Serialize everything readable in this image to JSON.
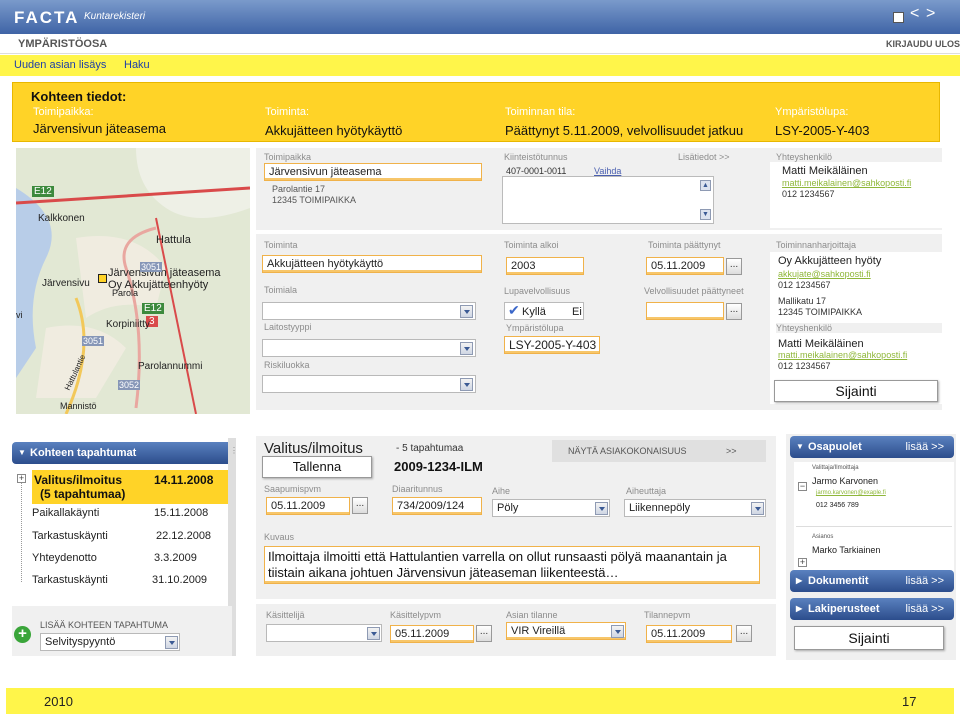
{
  "header": {
    "logo": "FACTA",
    "logo_sub": "Kuntarekisteri",
    "section": "YMPÄRISTÖOSA",
    "logout": "KIRJAUDU ULOS"
  },
  "nav": [
    "Uuden asian lisäys",
    "Haku"
  ],
  "case": {
    "heading": "Kohteen tiedot:",
    "place_label": "Toimipaikka:",
    "place": "Järvensivun jäteasema",
    "activity_label": "Toiminta:",
    "activity": "Akkujätteen hyötykäyttö",
    "status_label": "Toiminnan tila:",
    "status": "Päättynyt 5.11.2009, velvollisuudet jatkuu",
    "permit_label": "Ympäristölupa:",
    "permit": "LSY-2005-Y-403"
  },
  "site": {
    "place_label": "Toimipaikka",
    "place_value": "Järvensivun jäteasema",
    "address1": "Parolantie 17",
    "address2": "12345 TOIMIPAIKKA",
    "property_label": "Kiinteistötunnus",
    "property_value": "407-0001-0011",
    "change_link": "Vaihda",
    "more_info": "Lisätiedot >>",
    "contact_label": "Yhteyshenkilö",
    "contact_name": "Matti Meikäläinen",
    "contact_email": "matti.meikalainen@sahkoposti.fi",
    "contact_phone": "012 1234567"
  },
  "activity": {
    "activity_label": "Toiminta",
    "activity_value": "Akkujätteen hyötykäyttö",
    "sector_label": "Toimiala",
    "type_label": "Laitostyyppi",
    "risk_label": "Riskiluokka",
    "started_label": "Toiminta alkoi",
    "started_value": "2003",
    "ended_label": "Toiminta päättynyt",
    "ended_value": "05.11.2009",
    "permit_req_label": "Lupavelvollisuus",
    "permit_req_value": "Kyllä",
    "permit_req_other": "Ei",
    "duties_ended_label": "Velvollisuudet päättyneet",
    "env_permit_label": "Ympäristölupa",
    "env_permit_value": "LSY-2005-Y-403",
    "operator_label": "Toiminnanharjoittaja",
    "operator_name": "Oy Akkujätteen hyöty",
    "operator_email": "akkujate@sahkoposti.fi",
    "operator_phone": "012 1234567",
    "operator_addr1": "Mallikatu 17",
    "operator_addr2": "12345 TOIMIPAIKKA",
    "contact_label": "Yhteyshenkilö",
    "contact_name": "Matti Meikäläinen",
    "contact_email": "matti.meikalainen@sahkoposti.fi",
    "contact_phone": "012 1234567",
    "location_button": "Sijainti"
  },
  "map": {
    "labels": [
      "E12",
      "Kalkkonen",
      "Hattula",
      "Järvensivu",
      "Järvensivun jäteasema",
      "Oy Akkujätteenhyöty",
      "Parola",
      "3051",
      "E12",
      "3",
      "Korpiniitty",
      "3051",
      "Parolannummi",
      "Hattulantie",
      "3052",
      "Mannistö",
      "vi"
    ]
  },
  "timeline": {
    "title": "Kohteen tapahtumat",
    "items": [
      {
        "name": "Valitus/ilmoitus",
        "sub": "(5 tapahtumaa)",
        "date": "14.11.2008"
      },
      {
        "name": "Paikallakäynti",
        "date": "15.11.2008"
      },
      {
        "name": "Tarkastuskäynti",
        "date": "22.12.2008"
      },
      {
        "name": "Yhteydenotto",
        "date": "3.3.2009"
      },
      {
        "name": "Tarkastuskäynti",
        "date": "31.10.2009"
      }
    ],
    "add_label": "LISÄÄ KOHTEEN TAPAHTUMA",
    "add_select": "Selvityspyyntö"
  },
  "event": {
    "title": "Valitus/ilmoitus",
    "count": "- 5 tapahtumaa",
    "show_all": "NÄYTÄ ASIAKOKONAISUUS",
    "show_all_arrow": ">>",
    "save": "Tallenna",
    "case_no": "2009-1234-ILM",
    "received_label": "Saapumispvm",
    "received_value": "05.11.2009",
    "diary_label": "Diaaritunnus",
    "diary_value": "734/2009/124",
    "subject_label": "Aihe",
    "subject_value": "Pöly",
    "cause_label": "Aiheuttaja",
    "cause_value": "Liikennepöly",
    "desc_label": "Kuvaus",
    "desc_value": "Ilmoittaja ilmoitti että Hattulantien varrella on ollut runsaasti pölyä maanantain ja tiistain aikana johtuen Järvensivun jäteaseman liikenteestä…",
    "handler_label": "Käsittelijä",
    "handled_label": "Käsittelypvm",
    "handled_value": "05.11.2009",
    "state_label": "Asian tilanne",
    "state_value": "VIR   Vireillä",
    "next_label": "Tilannepvm",
    "next_value": "05.11.2009",
    "location_button": "Sijainti"
  },
  "right": {
    "parties_title": "Osapuolet",
    "more": "lisää >>",
    "reporter_role": "Valittaja/Ilmoittaja",
    "reporter_name": "Jarmo Karvonen",
    "reporter_email": "jarmo.karvonen@exaple.fi",
    "reporter_phone": "012 3456 789",
    "party_role": "Asianos",
    "party_name": "Marko Tarkiainen",
    "documents_title": "Dokumentit",
    "documents_more": "lisää >>",
    "legal_title": "Lakiperusteet",
    "legal_more": "lisää >>"
  },
  "footer": {
    "year": "2010",
    "page": "17"
  }
}
